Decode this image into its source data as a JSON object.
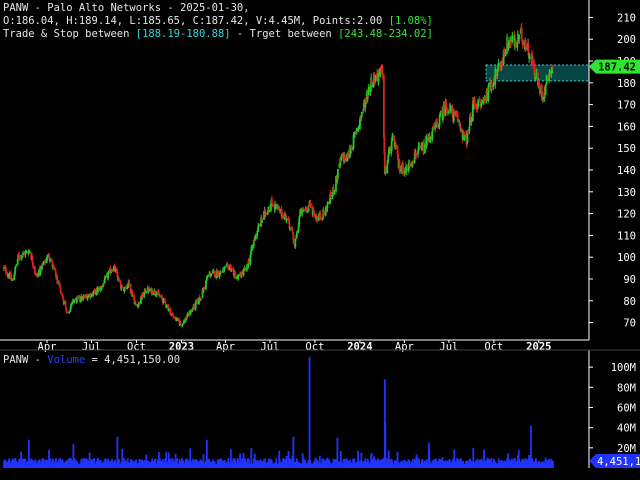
{
  "header": {
    "line1": "PANW - Palo Alto Networks - 2025-01-30,",
    "ohlc_text": "O:186.04, H:189.14, L:185.65, C:187.42, V:4.45M, Points:2.00 ",
    "pct_change": "[1.08%]",
    "trade_stop_label": "Trade & Stop between ",
    "trade_stop_range": "[188.19-180.88]",
    "target_label": " - Trget between ",
    "target_range": "[243.48-234.02]"
  },
  "volume_header": {
    "ticker": "PANW - ",
    "label": "Volume",
    "value_text": " = 4,451,150.00"
  },
  "colors": {
    "background": "#000000",
    "up": "#22cc22",
    "down": "#dd2222",
    "volume": "#2233ff",
    "axis": "#ffffff",
    "zone_fill": "#0b5e5e",
    "zone_border": "#39d6d6",
    "price_badge": "#2ee62e"
  },
  "chart_data": [
    {
      "type": "candlestick",
      "ticker": "PANW",
      "date_range": [
        "2022-01-03",
        "2025-01-30"
      ],
      "y_ticks": [
        70,
        80,
        90,
        100,
        110,
        120,
        130,
        140,
        150,
        160,
        170,
        180,
        190,
        200,
        210
      ],
      "ylim": [
        62,
        218
      ],
      "x_tick_labels": [
        "Apr",
        "Jul",
        "Oct",
        "2023",
        "Apr",
        "Jul",
        "Oct",
        "2024",
        "Apr",
        "Jul",
        "Oct",
        "2025"
      ],
      "x_tick_dates": [
        "2022-04-01",
        "2022-07-01",
        "2022-10-01",
        "2023-01-01",
        "2023-04-01",
        "2023-07-01",
        "2023-10-01",
        "2024-01-01",
        "2024-04-01",
        "2024-07-01",
        "2024-10-01",
        "2025-01-01"
      ],
      "bold_ticks": [
        "2023",
        "2024",
        "2025"
      ],
      "last_price": 187.42,
      "last_price_label": "187.42",
      "zone": {
        "low": 180.88,
        "high": 188.19,
        "start": "2024-09-15",
        "end": "2025-01-30"
      },
      "anchors": [
        [
          "2022-01-03",
          95
        ],
        [
          "2022-01-20",
          89
        ],
        [
          "2022-02-01",
          100
        ],
        [
          "2022-02-25",
          103
        ],
        [
          "2022-03-10",
          91
        ],
        [
          "2022-04-05",
          101
        ],
        [
          "2022-05-01",
          83
        ],
        [
          "2022-05-13",
          74
        ],
        [
          "2022-05-25",
          80
        ],
        [
          "2022-06-10",
          81
        ],
        [
          "2022-07-01",
          83
        ],
        [
          "2022-07-20",
          86
        ],
        [
          "2022-08-15",
          96
        ],
        [
          "2022-09-01",
          85
        ],
        [
          "2022-09-15",
          88
        ],
        [
          "2022-10-01",
          77
        ],
        [
          "2022-10-20",
          85
        ],
        [
          "2022-11-10",
          84
        ],
        [
          "2022-11-25",
          80
        ],
        [
          "2022-12-15",
          73
        ],
        [
          "2023-01-01",
          69
        ],
        [
          "2023-01-20",
          75
        ],
        [
          "2023-02-10",
          82
        ],
        [
          "2023-02-25",
          92
        ],
        [
          "2023-03-20",
          93
        ],
        [
          "2023-04-10",
          96
        ],
        [
          "2023-04-25",
          90
        ],
        [
          "2023-05-15",
          95
        ],
        [
          "2023-06-01",
          110
        ],
        [
          "2023-06-20",
          120
        ],
        [
          "2023-07-05",
          125
        ],
        [
          "2023-07-20",
          121
        ],
        [
          "2023-08-05",
          118
        ],
        [
          "2023-08-15",
          112
        ],
        [
          "2023-08-20",
          104
        ],
        [
          "2023-09-01",
          120
        ],
        [
          "2023-09-20",
          124
        ],
        [
          "2023-10-05",
          118
        ],
        [
          "2023-10-20",
          120
        ],
        [
          "2023-11-10",
          132
        ],
        [
          "2023-11-25",
          146
        ],
        [
          "2023-12-05",
          145
        ],
        [
          "2023-12-20",
          154
        ],
        [
          "2024-01-10",
          170
        ],
        [
          "2024-01-25",
          181
        ],
        [
          "2024-02-10",
          184
        ],
        [
          "2024-02-16",
          185
        ],
        [
          "2024-02-21",
          138
        ],
        [
          "2024-03-01",
          148
        ],
        [
          "2024-03-10",
          155
        ],
        [
          "2024-03-20",
          142
        ],
        [
          "2024-04-05",
          140
        ],
        [
          "2024-04-25",
          148
        ],
        [
          "2024-05-10",
          150
        ],
        [
          "2024-05-25",
          156
        ],
        [
          "2024-06-10",
          162
        ],
        [
          "2024-06-25",
          170
        ],
        [
          "2024-07-10",
          165
        ],
        [
          "2024-07-20",
          163
        ],
        [
          "2024-08-05",
          152
        ],
        [
          "2024-08-20",
          170
        ],
        [
          "2024-09-05",
          170
        ],
        [
          "2024-09-20",
          176
        ],
        [
          "2024-10-01",
          182
        ],
        [
          "2024-10-15",
          188
        ],
        [
          "2024-10-25",
          196
        ],
        [
          "2024-11-05",
          200
        ],
        [
          "2024-11-15",
          198
        ],
        [
          "2024-11-25",
          202
        ],
        [
          "2024-12-05",
          198
        ],
        [
          "2024-12-15",
          193
        ],
        [
          "2024-12-22",
          186
        ],
        [
          "2025-01-05",
          176
        ],
        [
          "2025-01-12",
          175
        ],
        [
          "2025-01-20",
          184
        ],
        [
          "2025-01-30",
          187.42
        ]
      ]
    },
    {
      "type": "bar",
      "series_name": "Volume",
      "y_ticks": [
        20,
        40,
        60,
        80,
        100
      ],
      "y_tick_labels": [
        "20M",
        "40M",
        "60M",
        "80M",
        "100M"
      ],
      "ylim": [
        0,
        115
      ],
      "base_volume_millions": 5.5,
      "last_value_label": "4,451,150",
      "spikes": [
        [
          "2022-02-23",
          28
        ],
        [
          "2022-05-25",
          24
        ],
        [
          "2022-08-23",
          31
        ],
        [
          "2022-11-16",
          16
        ],
        [
          "2023-02-22",
          28
        ],
        [
          "2023-05-24",
          20
        ],
        [
          "2023-08-18",
          31
        ],
        [
          "2023-09-20",
          110
        ],
        [
          "2023-11-16",
          30
        ],
        [
          "2024-02-21",
          88
        ],
        [
          "2024-02-22",
          45
        ],
        [
          "2024-05-21",
          25
        ],
        [
          "2024-08-20",
          20
        ],
        [
          "2024-11-21",
          18
        ],
        [
          "2024-12-16",
          42
        ]
      ]
    }
  ]
}
